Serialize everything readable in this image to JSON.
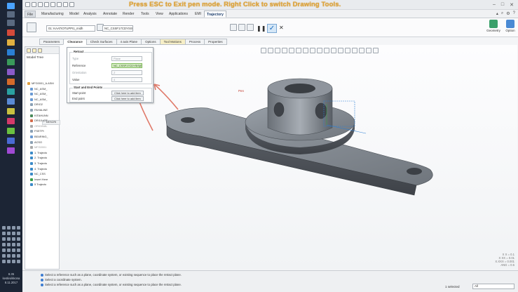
{
  "titlebar": {
    "message": "Press ESC to Exit pen mode.  Right Click to switch Drawing Tools."
  },
  "tabs": [
    {
      "label": "File",
      "active": false
    },
    {
      "label": "Manufacturing",
      "active": false
    },
    {
      "label": "Model",
      "active": false
    },
    {
      "label": "Analysis",
      "active": false
    },
    {
      "label": "Annotate",
      "active": false
    },
    {
      "label": "Render",
      "active": false
    },
    {
      "label": "Tools",
      "active": false
    },
    {
      "label": "View",
      "active": false
    },
    {
      "label": "Applications",
      "active": false
    },
    {
      "label": "EMI",
      "active": false
    },
    {
      "label": "Trajectory",
      "active": true
    }
  ],
  "ribbon": {
    "tool_select": "01: KAATIOTUPPI1_midh",
    "csys_select": "NC_CSSF17CDYSIS",
    "geometry_label": "Geometry",
    "options_label": "Option"
  },
  "subtabs": [
    {
      "label": "Parameters"
    },
    {
      "label": "Clearance"
    },
    {
      "label": "Check Surfaces"
    },
    {
      "label": "4 axis Plane"
    },
    {
      "label": "Options"
    },
    {
      "label": "Tool Motions"
    },
    {
      "label": "Process"
    },
    {
      "label": "Properties"
    }
  ],
  "left_panel": {
    "title": "Model Tree",
    "column_header": "DESCRI",
    "items": [
      {
        "label": "MFG0001_A.ASM",
        "dim": false
      },
      {
        "label": "NC_ASM_",
        "dim": false
      },
      {
        "label": "NC_ASM_",
        "dim": false
      },
      {
        "label": "NC_ASM_",
        "dim": false
      },
      {
        "label": "DRIO2",
        "dim": false
      },
      {
        "label": "PAHALINE",
        "dim": false
      },
      {
        "label": "KITAHUNN",
        "dim": false
      },
      {
        "label": "DRI10 (OT",
        "dim": false
      },
      {
        "label": "ORIGINAL",
        "dim": true
      },
      {
        "label": "FSETPI",
        "dim": false
      },
      {
        "label": "BEARING_",
        "dim": false
      },
      {
        "label": "ACSO",
        "dim": false
      },
      {
        "label": "MFG0001",
        "dim": true
      },
      {
        "label": "1. Trajecto",
        "dim": false
      },
      {
        "label": "2. Trajecto",
        "dim": false
      },
      {
        "label": "3. Trajecto",
        "dim": false
      },
      {
        "label": "4. Trajecto",
        "dim": false
      },
      {
        "label": "NC_CSS",
        "dim": false
      },
      {
        "label": "Insert Here",
        "dim": false
      },
      {
        "label": "5 Trajecto",
        "dim": false
      }
    ]
  },
  "clearance": {
    "retract_legend": "Retract",
    "type_label": "Type",
    "type_value": "Plane",
    "reference_label": "Reference",
    "reference_value": "NC_CSSF17CDYSIS(ENT1)",
    "orientation_label": "Orientation",
    "orientation_value": "Z",
    "value_label": "Value",
    "value_value": "4",
    "start_end_legend": "Start and End Points",
    "start_label": "Start point",
    "start_button": "Click here to add item",
    "end_label": "End point",
    "end_button": "Click here to add item"
  },
  "graphics": {
    "pen_label": "Pen",
    "coords": [
      "X X = 0.1",
      "X XX = 0.01",
      "X.XXX = 0.001",
      "ANG = 0.5"
    ]
  },
  "status": {
    "messages": [
      "Select a reference such as a plane, coordinate system, or existing sequence to place the retract plane.",
      "Select a coordinate system.",
      "Select a reference such as a plane, coordinate system, or existing sequence to place the retract plane."
    ],
    "selected_count": "1 selected",
    "filter_value": "All"
  },
  "taskbar": {
    "time": "8.35",
    "day": "keskiviikkona",
    "date": "8.11.2017"
  },
  "colors": {
    "model": "#6c737c",
    "highlight_field": "#d7f0c4",
    "annotation_pen": "#e07a6a",
    "esc_message": "#e0a63c"
  }
}
